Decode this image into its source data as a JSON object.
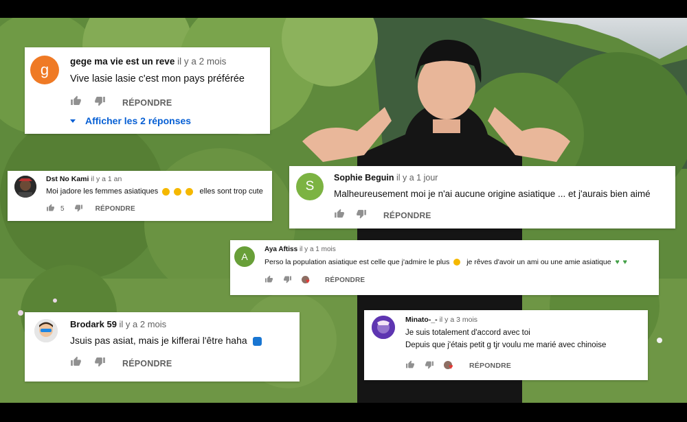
{
  "comments": [
    {
      "author": "gege ma vie est un reve",
      "time": "il y a 2 mois",
      "text": "Vive lasie lasie c'est mon pays préférée",
      "avatar_letter": "g",
      "avatar_color": "#ef7a25",
      "reply_label": "RÉPONDRE",
      "replies_link": "Afficher les 2 réponses"
    },
    {
      "author": "Dst No Kami",
      "time": "il y a 1 an",
      "text": "Moi jadore les femmes asiatiques",
      "text_after_emoji": "elles sont trop cute",
      "emoji": [
        "heart-eyes-emoji",
        "heart-eyes-emoji",
        "heart-eyes-emoji"
      ],
      "likes": "5",
      "reply_label": "RÉPONDRE"
    },
    {
      "author": "Sophie Beguin",
      "time": "il y a 1 jour",
      "text": "Malheureusement moi je n'ai aucune origine asiatique ... et j'aurais bien aimé",
      "avatar_letter": "S",
      "avatar_color": "#7cb342",
      "reply_label": "RÉPONDRE"
    },
    {
      "author": "Aya Aftiss",
      "time": "il y a 1 mois",
      "text": "Perso la population asiatique est celle que j'admire le plus",
      "text_after_emoji": "je rêves d'avoir un ami ou une amie asiatique",
      "avatar_letter": "A",
      "avatar_color": "#689f38",
      "reply_label": "RÉPONDRE"
    },
    {
      "author": "Brodark 59",
      "time": "il y a 2 mois",
      "text": "Jsuis pas asiat, mais je kifferai l'être haha",
      "reply_label": "RÉPONDRE"
    },
    {
      "author": "Minato-_-",
      "time": "il y a 3 mois",
      "text_line1": "Je suis totalement d'accord avec toi",
      "text_line2": "Depuis que j'étais petit g tjr voulu me marié avec chinoise",
      "reply_label": "RÉPONDRE"
    }
  ],
  "colors": {
    "link": "#065fd4",
    "secondary_text": "#606060",
    "heart": "#e53935"
  }
}
